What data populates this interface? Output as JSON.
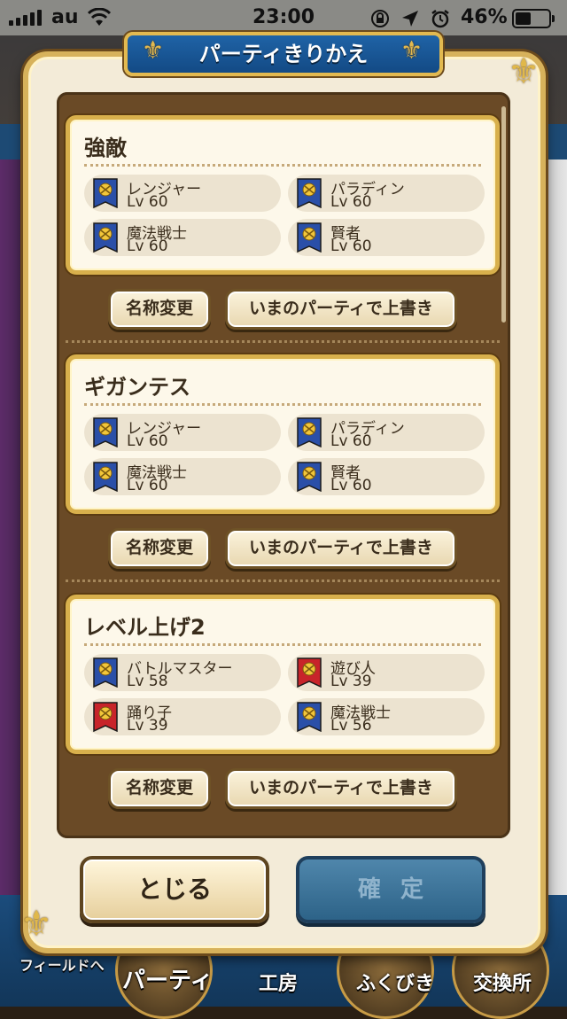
{
  "status_bar": {
    "carrier": "au",
    "time": "23:00",
    "battery": "46%",
    "battery_level": 0.46
  },
  "dialog": {
    "title": "パーティきりかえ"
  },
  "parties": [
    {
      "name": "強敵",
      "members": [
        {
          "job": "レンジャー",
          "level": "Lv 60",
          "emblem_color": "#2a4fa8",
          "icon": "ranger-emblem-icon"
        },
        {
          "job": "パラディン",
          "level": "Lv 60",
          "emblem_color": "#2a4fa8",
          "icon": "paladin-emblem-icon"
        },
        {
          "job": "魔法戦士",
          "level": "Lv 60",
          "emblem_color": "#2a4fa8",
          "icon": "magic-warrior-emblem-icon"
        },
        {
          "job": "賢者",
          "level": "Lv 60",
          "emblem_color": "#2a4fa8",
          "icon": "sage-emblem-icon"
        }
      ],
      "rename_label": "名称変更",
      "overwrite_label": "いまのパーティで上書き"
    },
    {
      "name": "ギガンテス",
      "members": [
        {
          "job": "レンジャー",
          "level": "Lv 60",
          "emblem_color": "#2a4fa8",
          "icon": "ranger-emblem-icon"
        },
        {
          "job": "パラディン",
          "level": "Lv 60",
          "emblem_color": "#2a4fa8",
          "icon": "paladin-emblem-icon"
        },
        {
          "job": "魔法戦士",
          "level": "Lv 60",
          "emblem_color": "#2a4fa8",
          "icon": "magic-warrior-emblem-icon"
        },
        {
          "job": "賢者",
          "level": "Lv 60",
          "emblem_color": "#2a4fa8",
          "icon": "sage-emblem-icon"
        }
      ],
      "rename_label": "名称変更",
      "overwrite_label": "いまのパーティで上書き"
    },
    {
      "name": "レベル上げ2",
      "members": [
        {
          "job": "バトルマスター",
          "level": "Lv 58",
          "emblem_color": "#2a4fa8",
          "icon": "battle-master-emblem-icon"
        },
        {
          "job": "遊び人",
          "level": "Lv 39",
          "emblem_color": "#c8242a",
          "icon": "gadabout-emblem-icon"
        },
        {
          "job": "踊り子",
          "level": "Lv 39",
          "emblem_color": "#c8242a",
          "icon": "dancer-emblem-icon"
        },
        {
          "job": "魔法戦士",
          "level": "Lv 56",
          "emblem_color": "#2a4fa8",
          "icon": "magic-warrior-emblem-icon"
        }
      ],
      "rename_label": "名称変更",
      "overwrite_label": "いまのパーティで上書き"
    }
  ],
  "footer": {
    "close_label": "とじる",
    "confirm_label": "確定"
  },
  "bottom_nav": {
    "field": "フィールドへ",
    "party": "パーティ",
    "workshop": "工房",
    "gacha": "ふくびき",
    "exchange": "交換所"
  },
  "colors": {
    "gold": "#d8b04c",
    "brown": "#6a4a26",
    "blue_banner": "#1f63a6"
  }
}
